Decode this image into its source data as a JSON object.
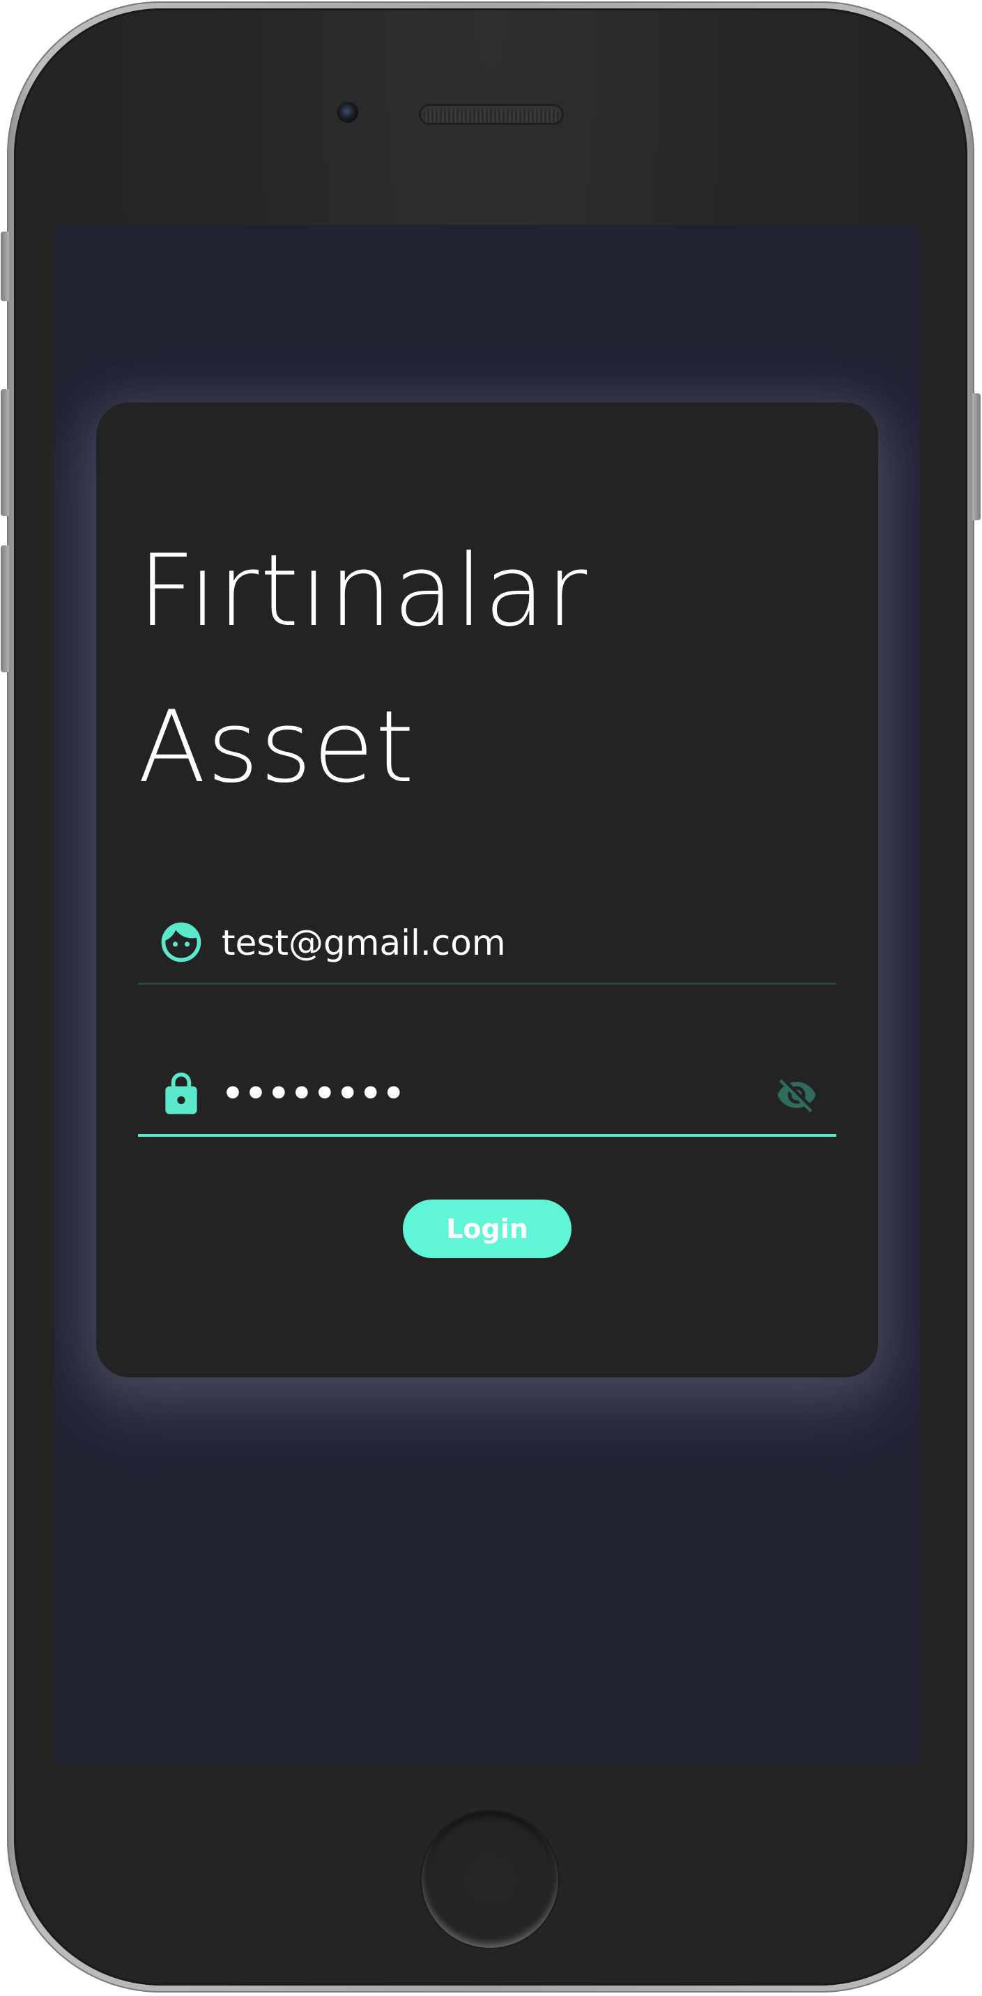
{
  "app": {
    "title_line1": "Fırtınalar",
    "title_line2": "Asset"
  },
  "login_form": {
    "email": {
      "icon": "face-icon",
      "value": "test@gmail.com"
    },
    "password": {
      "icon": "lock-icon",
      "value": "••••••••",
      "visibility_icon": "visibility-off-icon"
    },
    "login_button_label": "Login"
  },
  "colors": {
    "accent": "#5ff5d6",
    "screen_background": "#212232",
    "card_background": "#232323",
    "muted_accent": "#2e6b5c"
  }
}
